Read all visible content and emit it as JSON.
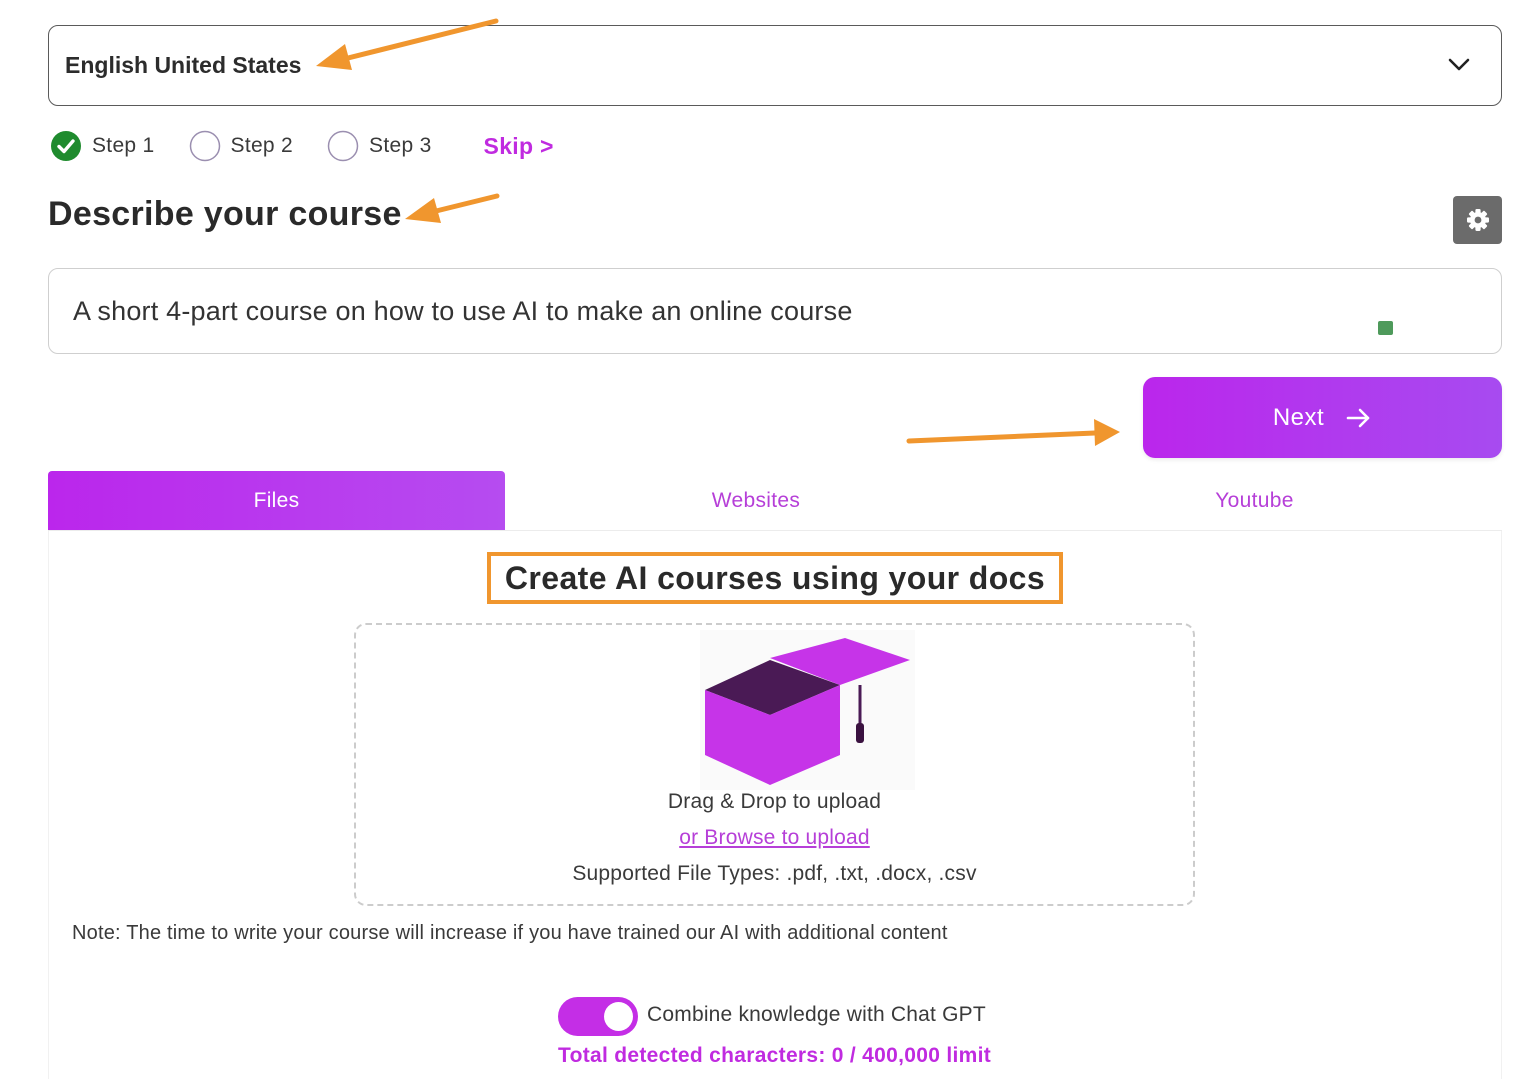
{
  "language_select": {
    "value": "English United States",
    "icon": "chevron-down-icon"
  },
  "steps": [
    {
      "label": "Step 1",
      "state": "completed"
    },
    {
      "label": "Step 2",
      "state": "pending"
    },
    {
      "label": "Step 3",
      "state": "pending"
    }
  ],
  "skip_label": "Skip >",
  "heading": "Describe your course",
  "settings_icon": "gear-icon",
  "course_description": "A short 4-part course on how to use AI to make an online course",
  "next_button": {
    "label": "Next",
    "icon": "arrow-right-icon"
  },
  "tabs": [
    {
      "label": "Files",
      "active": true
    },
    {
      "label": "Websites",
      "active": false
    },
    {
      "label": "Youtube",
      "active": false
    }
  ],
  "files_panel": {
    "title": "Create AI courses using your docs",
    "illustration": "graduation-cap-icon",
    "drag_text": "Drag & Drop to upload",
    "browse_link": "or Browse to upload",
    "supported_types": "Supported File Types: .pdf, .txt, .docx, .csv",
    "note": "Note: The time to write your course will increase if you have trained our AI with additional content",
    "toggle": {
      "label": "Combine knowledge with Chat GPT",
      "on": true
    },
    "char_count": "Total detected characters: 0 / 400,000 limit"
  },
  "colors": {
    "accent": "#c02be0",
    "accent_gradient_end": "#a74bf0",
    "annotation": "#f0962e",
    "check_green": "#1f8b2e"
  }
}
